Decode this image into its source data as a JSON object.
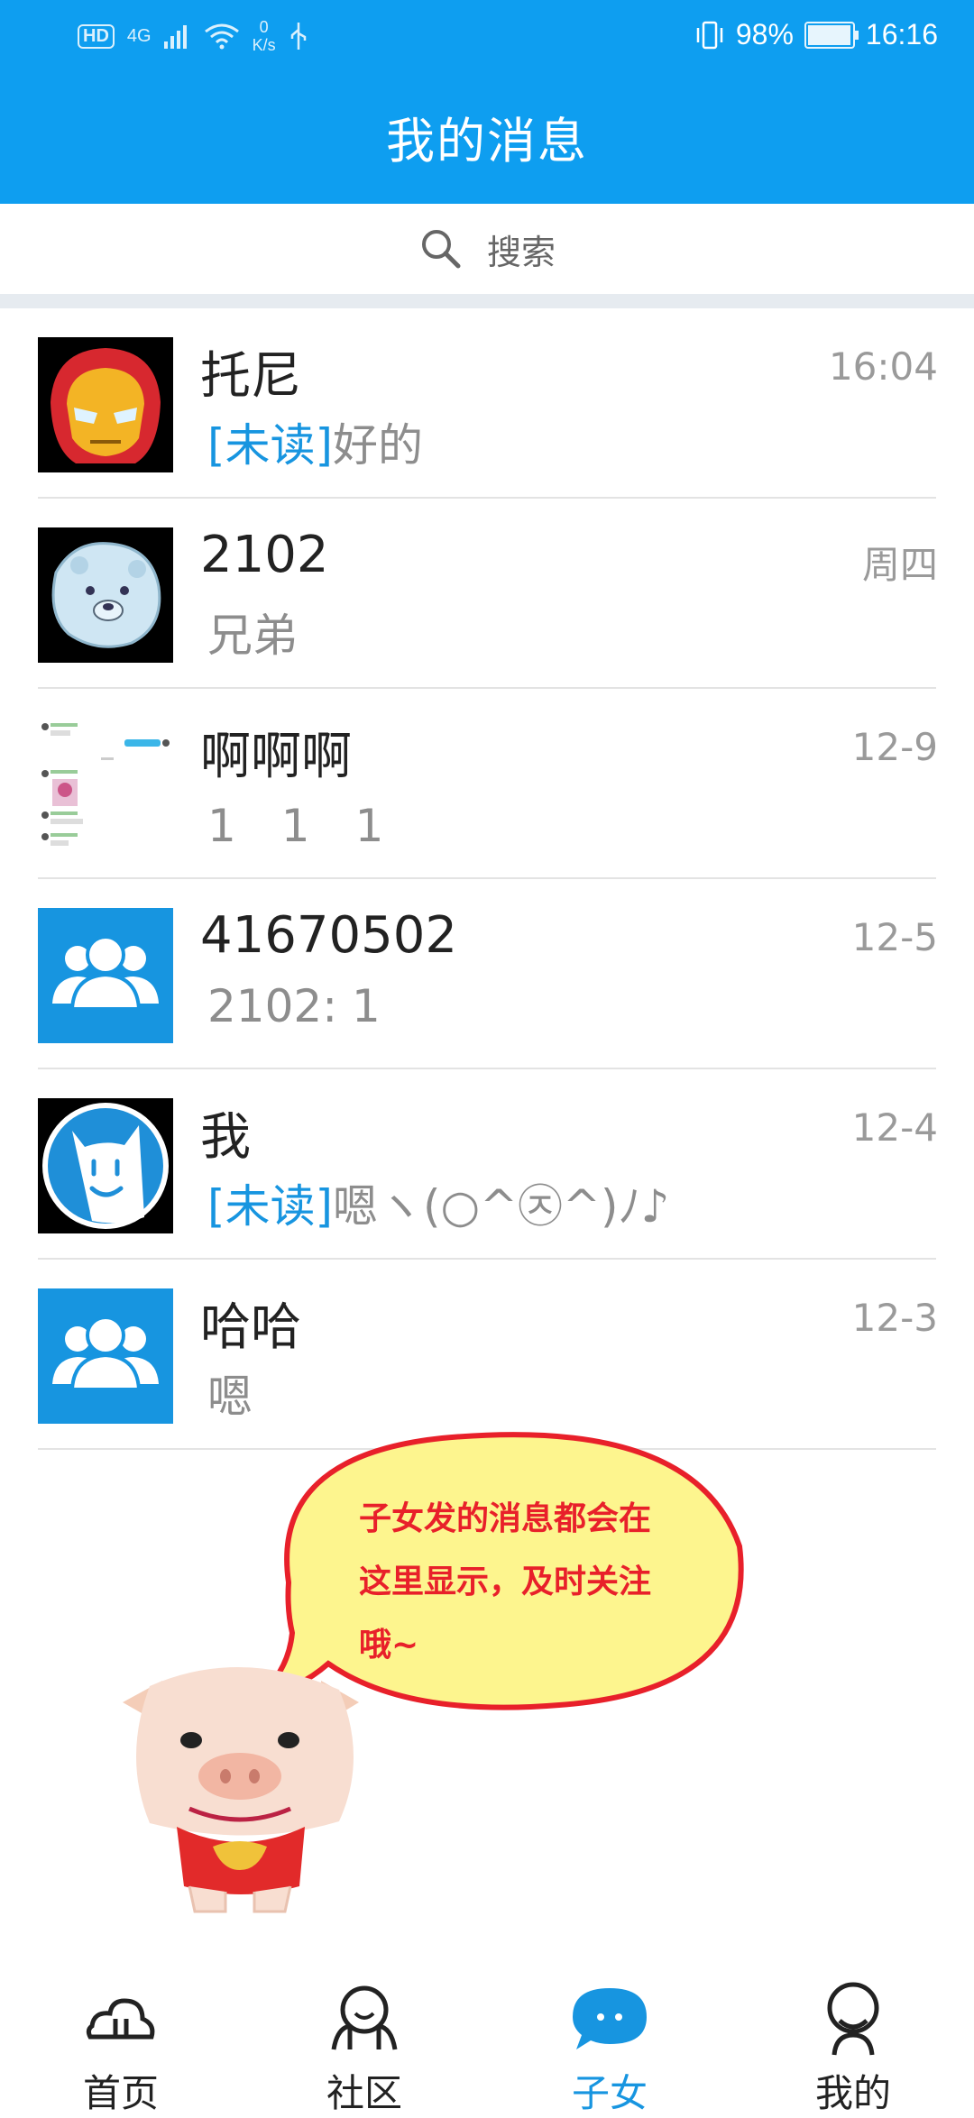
{
  "status_bar": {
    "hd": "HD",
    "network": "4G",
    "speed_value": "0",
    "speed_unit": "K/s",
    "battery": "98%",
    "battery_level": 0.98,
    "time": "16:16"
  },
  "header": {
    "title": "我的消息"
  },
  "search": {
    "placeholder": "搜索"
  },
  "conversations": [
    {
      "name": "托尼",
      "time": "16:04",
      "unread_tag": "[未读]",
      "preview": "好的",
      "avatar": "ironman-avatar"
    },
    {
      "name": "2102",
      "time": "周四",
      "unread_tag": "",
      "preview": "兄弟",
      "avatar": "ice-bear-avatar"
    },
    {
      "name": "啊啊啊",
      "time": "12-9",
      "unread_tag": "",
      "preview": "1　1　1",
      "avatar": "chat-screenshot-avatar"
    },
    {
      "name": "41670502",
      "time": "12-5",
      "unread_tag": "",
      "preview": "2102: 1",
      "avatar": "group-icon"
    },
    {
      "name": "我",
      "time": "12-4",
      "unread_tag": "[未读]",
      "preview": "嗯ヽ(○^㉨^)ﾉ♪",
      "avatar": "cat-face-avatar"
    },
    {
      "name": "哈哈",
      "time": "12-3",
      "unread_tag": "",
      "preview": "嗯",
      "avatar": "group-icon"
    }
  ],
  "tip_bubble": {
    "lines": [
      "子女发的消息都会在",
      "这里显示，及时关注",
      "哦~"
    ]
  },
  "tabbar": {
    "tabs": [
      {
        "label": "首页",
        "icon": "cloud-home-icon"
      },
      {
        "label": "社区",
        "icon": "community-icon"
      },
      {
        "label": "子女",
        "icon": "chat-bubble-icon"
      },
      {
        "label": "我的",
        "icon": "profile-icon"
      }
    ],
    "active_index": 2
  },
  "colors": {
    "primary": "#0e9ef0",
    "unread": "#1795e0",
    "tip_text": "#e8202a",
    "bubble_fill": "#fdf58e",
    "bubble_stroke": "#e8202a"
  }
}
